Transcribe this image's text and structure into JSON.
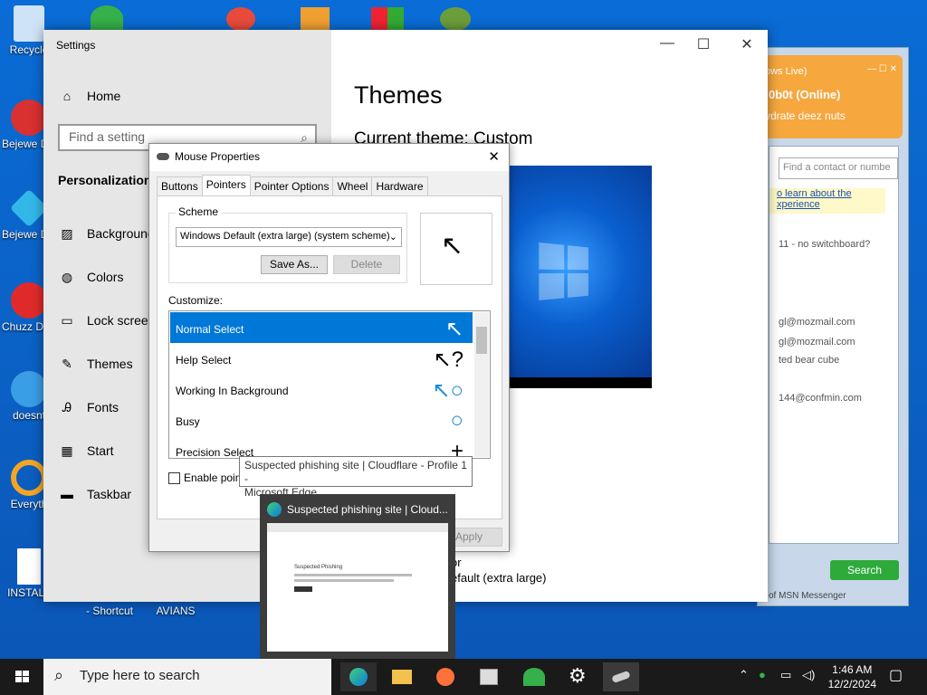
{
  "desktop": {
    "icons": [
      {
        "label": "Recycle",
        "color": "#9fc7ef"
      },
      {
        "label": "Bejewe Delux",
        "color": "#d93030"
      },
      {
        "label": "Bejewe Delux",
        "color": "#32b7e8"
      },
      {
        "label": "Chuzz Delux",
        "color": "#e02a2a"
      },
      {
        "label": "doesnt",
        "color": "#3a9ee6"
      },
      {
        "label": "Everyth",
        "color": "#f3a625"
      },
      {
        "label": "INSTALL",
        "color": "#ffffff"
      }
    ],
    "bottom_labels": [
      "- Shortcut",
      "AVIANS"
    ]
  },
  "settings": {
    "window_title": "Settings",
    "home": "Home",
    "search_placeholder": "Find a setting",
    "section": "Personalization",
    "nav": [
      {
        "label": "Background",
        "icon": "image-icon"
      },
      {
        "label": "Colors",
        "icon": "palette-icon"
      },
      {
        "label": "Lock screen",
        "icon": "lock-screen-icon"
      },
      {
        "label": "Themes",
        "icon": "brush-icon"
      },
      {
        "label": "Fonts",
        "icon": "fonts-icon"
      },
      {
        "label": "Start",
        "icon": "start-icon"
      },
      {
        "label": "Taskbar",
        "icon": "taskbar-icon"
      }
    ],
    "page_title": "Themes",
    "current_theme": "Current theme: Custom",
    "under_text_1": "or",
    "under_text_2": "efault (extra large)"
  },
  "mouse_properties": {
    "title": "Mouse Properties",
    "tabs": [
      "Buttons",
      "Pointers",
      "Pointer Options",
      "Wheel",
      "Hardware"
    ],
    "active_tab": "Pointers",
    "scheme_label": "Scheme",
    "scheme_value": "Windows Default (extra large) (system scheme)",
    "save_as": "Save As...",
    "delete": "Delete",
    "customize_label": "Customize:",
    "pointers": [
      {
        "name": "Normal Select",
        "glyph": "↖"
      },
      {
        "name": "Help Select",
        "glyph": "↖?"
      },
      {
        "name": "Working In Background",
        "glyph": "↖○"
      },
      {
        "name": "Busy",
        "glyph": "○"
      },
      {
        "name": "Precision Select",
        "glyph": "+"
      }
    ],
    "enable_shadow": "Enable pointe",
    "apply": "Apply"
  },
  "tooltip": {
    "line1": "Suspected phishing site | Cloudflare - Profile 1 -",
    "line2": "Microsoft Edge"
  },
  "thumbnail": {
    "title": "Suspected phishing site | Cloud...",
    "page_heading": "Suspected Phishing"
  },
  "messenger": {
    "header1": "ows Live)",
    "status": "0b0t (Online)",
    "message": "ydrate deez nuts",
    "search_placeholder": "Find a contact or numbe",
    "tip": "o learn about the xperience",
    "items": [
      "11 - no switchboard?",
      "gl@mozmail.com",
      "gl@mozmail.com",
      "ted bear cube",
      "144@confmin.com"
    ],
    "search_button": "Search",
    "footer": "of MSN Messenger"
  },
  "taskbar": {
    "search_placeholder": "Type here to search",
    "time": "1:46 AM",
    "date": "12/2/2024",
    "accent": "#0078d7"
  }
}
